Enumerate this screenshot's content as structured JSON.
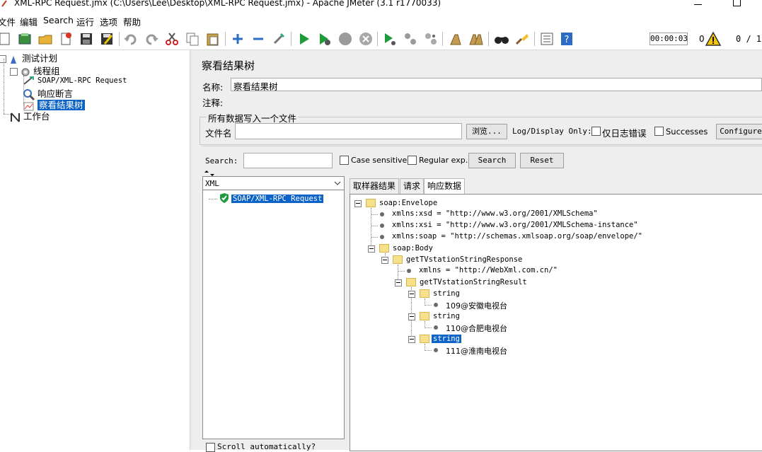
{
  "window": {
    "title": "XML-RPC Request.jmx (C:\\Users\\Lee\\Desktop\\XML-RPC Request.jmx) - Apache JMeter (3.1 r1770033)"
  },
  "menu": [
    "文件",
    "编辑",
    "Search",
    "运行",
    "选项",
    "帮助"
  ],
  "toolbar": {
    "icons": [
      "new-icon",
      "templates-icon",
      "open-icon",
      "close-icon",
      "save-icon",
      "save-as-icon",
      "undo-icon",
      "redo-icon",
      "cut-icon",
      "copy-icon",
      "paste-icon",
      "expand-icon",
      "collapse-icon",
      "toggle-icon",
      "start-icon",
      "start-no-pause-icon",
      "stop-icon",
      "shutdown-icon",
      "remote-start-icon",
      "remote-stop-icon",
      "remote-shutdown-icon",
      "clear-icon",
      "clear-all-icon",
      "search-icon",
      "reset-search-icon",
      "function-helper-icon",
      "help-icon"
    ],
    "timer": "00:00:03",
    "warnings": "0",
    "threads": "0 / 1",
    "warning_color": "#f5c400"
  },
  "left_tree": {
    "nodes": [
      {
        "label": "测试计划",
        "icon": "test-plan-icon"
      },
      {
        "label": "线程组",
        "icon": "thread-group-icon"
      },
      {
        "label": "SOAP/XML-RPC Request",
        "icon": "sampler-icon"
      },
      {
        "label": "响应断言",
        "icon": "assertion-icon"
      },
      {
        "label": "察看结果树",
        "icon": "listener-icon",
        "selected": true
      },
      {
        "label": "工作台",
        "icon": "workbench-icon"
      }
    ]
  },
  "panel": {
    "title": "察看结果树",
    "name_label": "名称:",
    "name_value": "察看结果树",
    "comment_label": "注释:",
    "comment_value": "",
    "file_group_title": "所有数据写入一个文件",
    "filename_label": "文件名",
    "filename_value": "",
    "browse_label": "浏览...",
    "log_display_label": "Log/Display Only:",
    "errors_only_label": "仅日志错误",
    "successes_label": "Successes",
    "configure_label": "Configure"
  },
  "search": {
    "label": "Search:",
    "value": "",
    "case_sensitive_label": "Case sensitive",
    "regex_label": "Regular exp.",
    "search_button": "Search",
    "reset_button": "Reset"
  },
  "results": {
    "renderer": "XML",
    "items": [
      {
        "label": "SOAP/XML-RPC Request",
        "status": "success"
      }
    ],
    "scroll_auto_label": "Scroll automatically?"
  },
  "tabs": [
    "取样器结果",
    "请求",
    "响应数据"
  ],
  "active_tab": 2,
  "xml_tree": [
    {
      "text": "soap:Envelope",
      "kind": "folder"
    },
    {
      "text": "xmlns:xsd = \"http://www.w3.org/2001/XMLSchema\"",
      "kind": "attr"
    },
    {
      "text": "xmlns:xsi = \"http://www.w3.org/2001/XMLSchema-instance\"",
      "kind": "attr"
    },
    {
      "text": "xmlns:soap = \"http://schemas.xmlsoap.org/soap/envelope/\"",
      "kind": "attr"
    },
    {
      "text": "soap:Body",
      "kind": "folder"
    },
    {
      "text": "getTVstationStringResponse",
      "kind": "folder"
    },
    {
      "text": "xmlns = \"http://WebXml.com.cn/\"",
      "kind": "attr"
    },
    {
      "text": "getTVstationStringResult",
      "kind": "folder"
    },
    {
      "text": "string",
      "kind": "folder"
    },
    {
      "text": "109@安徽电视台",
      "kind": "value"
    },
    {
      "text": "string",
      "kind": "folder"
    },
    {
      "text": "110@合肥电视台",
      "kind": "value"
    },
    {
      "text": "string",
      "kind": "folder",
      "selected": true
    },
    {
      "text": "111@淮南电视台",
      "kind": "value"
    }
  ]
}
